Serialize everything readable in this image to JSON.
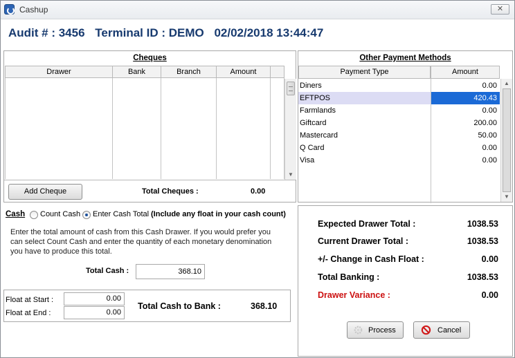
{
  "window": {
    "title": "Cashup",
    "close_glyph": "✕"
  },
  "header": {
    "audit": "Audit # : 3456",
    "terminal": "Terminal ID : DEMO",
    "datetime": "02/02/2018 13:44:47"
  },
  "cheques": {
    "title": "Cheques",
    "columns": [
      "Drawer",
      "Bank",
      "Branch",
      "Amount"
    ],
    "add_button": "Add Cheque",
    "total_label": "Total Cheques :",
    "total_value": "0.00"
  },
  "other_payments": {
    "title": "Other Payment Methods",
    "columns": [
      "Payment Type",
      "Amount"
    ],
    "rows": [
      {
        "type": "Diners",
        "amount": "0.00"
      },
      {
        "type": "EFTPOS",
        "amount": "420.43"
      },
      {
        "type": "Farmlands",
        "amount": "0.00"
      },
      {
        "type": "Giftcard",
        "amount": "200.00"
      },
      {
        "type": "Mastercard",
        "amount": "50.00"
      },
      {
        "type": "Q Card",
        "amount": "0.00"
      },
      {
        "type": "Visa",
        "amount": "0.00"
      }
    ]
  },
  "cash": {
    "label": "Cash",
    "option_count": "Count Cash",
    "option_total": "Enter Cash Total",
    "note": "(Include any float in your cash count)",
    "instructions_1": "Enter the total amount of cash from this Cash Drawer.  If you would prefer you",
    "instructions_2": "can select Count Cash and enter the quantity of each monetary denomination",
    "instructions_3": "you have to produce this total.",
    "total_label": "Total Cash :",
    "total_value": "368.10"
  },
  "float": {
    "start_label": "Float at Start :",
    "start_value": "0.00",
    "end_label": "Float at End :",
    "end_value": "0.00",
    "bank_label": "Total Cash to Bank :",
    "bank_value": "368.10"
  },
  "summary": {
    "expected_label": "Expected Drawer Total :",
    "expected_value": "1038.53",
    "current_label": "Current Drawer Total :",
    "current_value": "1038.53",
    "change_label": "+/- Change in Cash Float :",
    "change_value": "0.00",
    "banking_label": "Total Banking :",
    "banking_value": "1038.53",
    "variance_label": "Drawer Variance :",
    "variance_value": "0.00",
    "variance_color": "#cc1111"
  },
  "buttons": {
    "process": "Process",
    "cancel": "Cancel"
  }
}
